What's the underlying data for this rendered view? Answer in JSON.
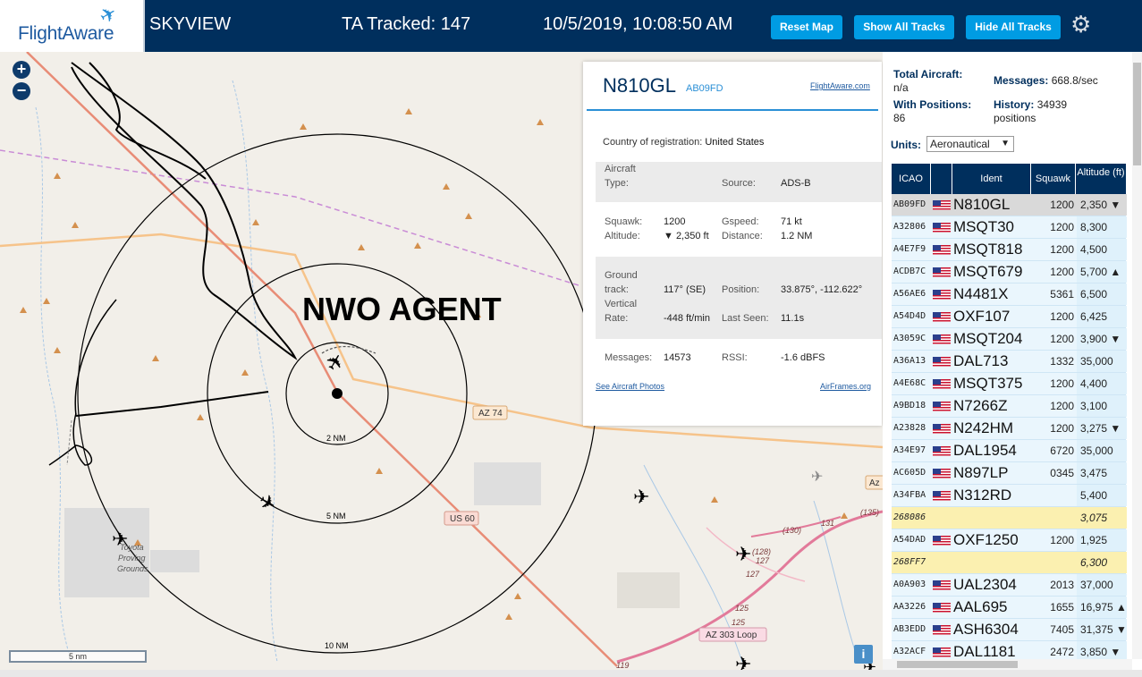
{
  "header": {
    "logo_text": "FlightAware",
    "site": "SKYVIEW",
    "ta_tracked": "TA Tracked: 147",
    "datetime": "10/5/2019, 10:08:50 AM",
    "buttons": [
      "Reset Map",
      "Show All Tracks",
      "Hide All Tracks"
    ]
  },
  "map": {
    "zoom_in": "+",
    "zoom_out": "−",
    "scale": "5 nm",
    "info": "i",
    "overlay_text": "NWO AGENT",
    "ring_labels": [
      "2 NM",
      "5 NM",
      "10 NM"
    ],
    "road_labels": [
      "AZ 74",
      "US 60",
      "AZ 303 Loop",
      "Az"
    ],
    "route_numbers": [
      "(130)",
      "131",
      "(135)",
      "(128)",
      "127",
      "127",
      "125",
      "125",
      "119"
    ],
    "place_labels": [
      "Toyota",
      "Proving",
      "Grounds"
    ]
  },
  "popup": {
    "ident": "N810GL",
    "hex": "AB09FD",
    "link_fa": "FlightAware.com",
    "country_label": "Country of registration:",
    "country_value": "United States",
    "aircraft_type_label": "Aircraft",
    "aircraft_type_label2": "Type:",
    "source_label": "Source:",
    "source_value": "ADS-B",
    "squawk_label": "Squawk:",
    "squawk_value": "1200",
    "altitude_label": "Altitude:",
    "altitude_value": "▼ 2,350 ft",
    "gspeed_label": "Gspeed:",
    "gspeed_value": "71 kt",
    "distance_label": "Distance:",
    "distance_value": "1.2 NM",
    "ground_label": "Ground",
    "track_label": "track:",
    "track_value": "117° (SE)",
    "vertical_label": "Vertical",
    "rate_label": "Rate:",
    "rate_value": "-448 ft/min",
    "position_label": "Position:",
    "position_value": "33.875°, -112.622°",
    "lastseen_label": "Last Seen:",
    "lastseen_value": "11.1s",
    "messages_label": "Messages:",
    "messages_value": "14573",
    "rssi_label": "RSSI:",
    "rssi_value": "-1.6 dBFS",
    "link_photos": "See Aircraft Photos",
    "link_airframes": "AirFrames.org"
  },
  "stats": {
    "total_label": "Total Aircraft:",
    "total_value": "n/a",
    "messages_label": "Messages:",
    "messages_value": "668.8/sec",
    "positions_label": "With Positions:",
    "positions_value": "86",
    "history_label": "History:",
    "history_value": "34939",
    "history_unit": "positions",
    "units_label": "Units:",
    "units_value": "Aeronautical"
  },
  "table": {
    "headers": [
      "ICAO",
      "",
      "Ident",
      "Squawk",
      "Altitude (ft)"
    ],
    "rows": [
      {
        "icao": "AB09FD",
        "flag": true,
        "ident": "N810GL",
        "squawk": "1200",
        "alt": "2,350 ▼",
        "style": "selected"
      },
      {
        "icao": "A32806",
        "flag": true,
        "ident": "MSQT30",
        "squawk": "1200",
        "alt": "8,300",
        "style": "normal"
      },
      {
        "icao": "A4E7F9",
        "flag": true,
        "ident": "MSQT818",
        "squawk": "1200",
        "alt": "4,500",
        "style": "normal"
      },
      {
        "icao": "ACDB7C",
        "flag": true,
        "ident": "MSQT679",
        "squawk": "1200",
        "alt": "5,700 ▲",
        "style": "normal"
      },
      {
        "icao": "A56AE6",
        "flag": true,
        "ident": "N4481X",
        "squawk": "5361",
        "alt": "6,500",
        "style": "normal"
      },
      {
        "icao": "A54D4D",
        "flag": true,
        "ident": "OXF107",
        "squawk": "1200",
        "alt": "6,425",
        "style": "normal"
      },
      {
        "icao": "A3059C",
        "flag": true,
        "ident": "MSQT204",
        "squawk": "1200",
        "alt": "3,900 ▼",
        "style": "normal"
      },
      {
        "icao": "A36A13",
        "flag": true,
        "ident": "DAL713",
        "squawk": "1332",
        "alt": "35,000",
        "style": "normal"
      },
      {
        "icao": "A4E68C",
        "flag": true,
        "ident": "MSQT375",
        "squawk": "1200",
        "alt": "4,400",
        "style": "normal"
      },
      {
        "icao": "A9BD18",
        "flag": true,
        "ident": "N7266Z",
        "squawk": "1200",
        "alt": "3,100",
        "style": "normal"
      },
      {
        "icao": "A23828",
        "flag": true,
        "ident": "N242HM",
        "squawk": "1200",
        "alt": "3,275 ▼",
        "style": "normal"
      },
      {
        "icao": "A34E97",
        "flag": true,
        "ident": "DAL1954",
        "squawk": "6720",
        "alt": "35,000",
        "style": "normal"
      },
      {
        "icao": "AC605D",
        "flag": true,
        "ident": "N897LP",
        "squawk": "0345",
        "alt": "3,475",
        "style": "normal"
      },
      {
        "icao": "A34FBA",
        "flag": true,
        "ident": "N312RD",
        "squawk": "",
        "alt": "5,400",
        "style": "normal"
      },
      {
        "icao": "268086",
        "flag": false,
        "ident": "",
        "squawk": "",
        "alt": "3,075",
        "style": "mlat"
      },
      {
        "icao": "A54DAD",
        "flag": true,
        "ident": "OXF1250",
        "squawk": "1200",
        "alt": "1,925",
        "style": "normal"
      },
      {
        "icao": "268FF7",
        "flag": false,
        "ident": "",
        "squawk": "",
        "alt": "6,300",
        "style": "mlat"
      },
      {
        "icao": "A0A903",
        "flag": true,
        "ident": "UAL2304",
        "squawk": "2013",
        "alt": "37,000",
        "style": "normal"
      },
      {
        "icao": "AA3226",
        "flag": true,
        "ident": "AAL695",
        "squawk": "1655",
        "alt": "16,975 ▲",
        "style": "normal"
      },
      {
        "icao": "AB3EDD",
        "flag": true,
        "ident": "ASH6304",
        "squawk": "7405",
        "alt": "31,375 ▼",
        "style": "normal"
      },
      {
        "icao": "A32ACF",
        "flag": true,
        "ident": "DAL1181",
        "squawk": "2472",
        "alt": "3,850 ▼",
        "style": "normal"
      }
    ]
  },
  "colors": {
    "header_bg": "#002f5d",
    "button_bg": "#009ce3",
    "row_normal": "#eaf6fd",
    "row_selected": "#d9d9d9",
    "row_mlat": "#fbf0b0",
    "road_us60": "#e88c76",
    "road_az74": "#f6c38a"
  }
}
